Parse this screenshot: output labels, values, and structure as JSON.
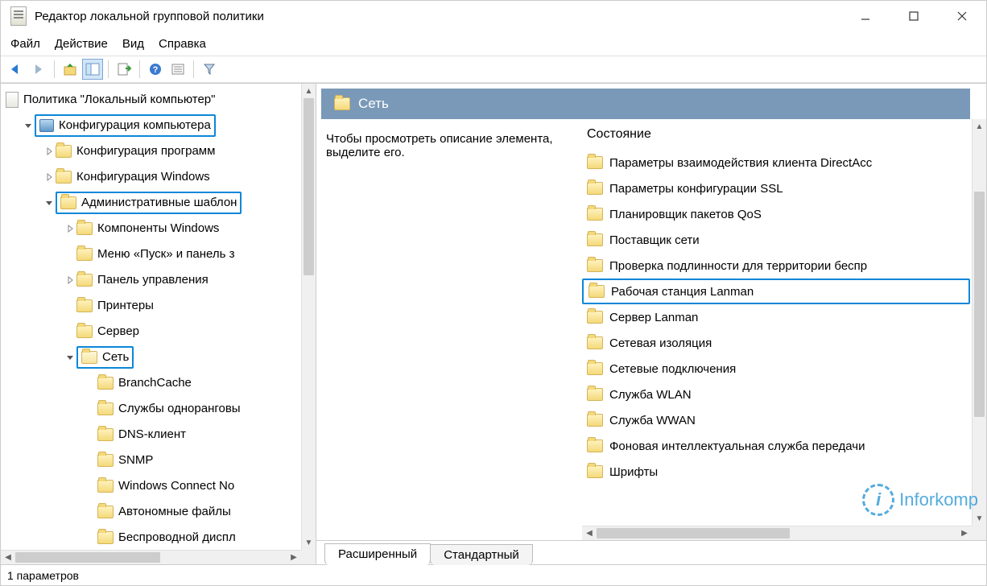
{
  "window": {
    "title": "Редактор локальной групповой политики"
  },
  "menu": {
    "items": [
      "Файл",
      "Действие",
      "Вид",
      "Справка"
    ]
  },
  "tree": {
    "root": "Политика \"Локальный компьютер\"",
    "nodes": [
      {
        "indent": 0,
        "exp": "open",
        "icon": "comp",
        "label": "Конфигурация компьютера",
        "hl": true
      },
      {
        "indent": 1,
        "exp": "closed",
        "icon": "folder",
        "label": "Конфигурация программ"
      },
      {
        "indent": 1,
        "exp": "closed",
        "icon": "folder",
        "label": "Конфигурация Windows"
      },
      {
        "indent": 1,
        "exp": "open",
        "icon": "folder",
        "label": "Административные шаблон",
        "hl": true
      },
      {
        "indent": 2,
        "exp": "closed",
        "icon": "folder",
        "label": "Компоненты Windows"
      },
      {
        "indent": 2,
        "exp": "none",
        "icon": "folder",
        "label": "Меню «Пуск» и панель з"
      },
      {
        "indent": 2,
        "exp": "closed",
        "icon": "folder",
        "label": "Панель управления"
      },
      {
        "indent": 2,
        "exp": "none",
        "icon": "folder",
        "label": "Принтеры"
      },
      {
        "indent": 2,
        "exp": "none",
        "icon": "folder",
        "label": "Сервер"
      },
      {
        "indent": 2,
        "exp": "open",
        "icon": "folder-open",
        "label": "Сеть",
        "hl": true
      },
      {
        "indent": 3,
        "exp": "none",
        "icon": "folder",
        "label": "BranchCache"
      },
      {
        "indent": 3,
        "exp": "none",
        "icon": "folder",
        "label": "Службы одноранговы"
      },
      {
        "indent": 3,
        "exp": "none",
        "icon": "folder",
        "label": "DNS-клиент"
      },
      {
        "indent": 3,
        "exp": "none",
        "icon": "folder",
        "label": "SNMP"
      },
      {
        "indent": 3,
        "exp": "none",
        "icon": "folder",
        "label": "Windows Connect No"
      },
      {
        "indent": 3,
        "exp": "none",
        "icon": "folder",
        "label": "Автономные файлы"
      },
      {
        "indent": 3,
        "exp": "none",
        "icon": "folder",
        "label": "Беспроводной диспл"
      }
    ]
  },
  "right": {
    "header": "Сеть",
    "description": "Чтобы просмотреть описание элемента, выделите его.",
    "column_header": "Состояние",
    "items": [
      {
        "label": "Параметры взаимодействия клиента DirectAcc"
      },
      {
        "label": "Параметры конфигурации SSL"
      },
      {
        "label": "Планировщик пакетов QoS"
      },
      {
        "label": "Поставщик сети"
      },
      {
        "label": "Проверка подлинности для территории беспр"
      },
      {
        "label": "Рабочая станция Lanman",
        "hl": true
      },
      {
        "label": "Сервер Lanman"
      },
      {
        "label": "Сетевая изоляция"
      },
      {
        "label": "Сетевые подключения"
      },
      {
        "label": "Служба WLAN"
      },
      {
        "label": "Служба WWAN"
      },
      {
        "label": "Фоновая интеллектуальная служба передачи"
      },
      {
        "label": "Шрифты"
      }
    ],
    "tabs": [
      "Расширенный",
      "Стандартный"
    ],
    "active_tab": 0
  },
  "statusbar": {
    "text": "1 параметров"
  },
  "watermark": "Inforkomp"
}
